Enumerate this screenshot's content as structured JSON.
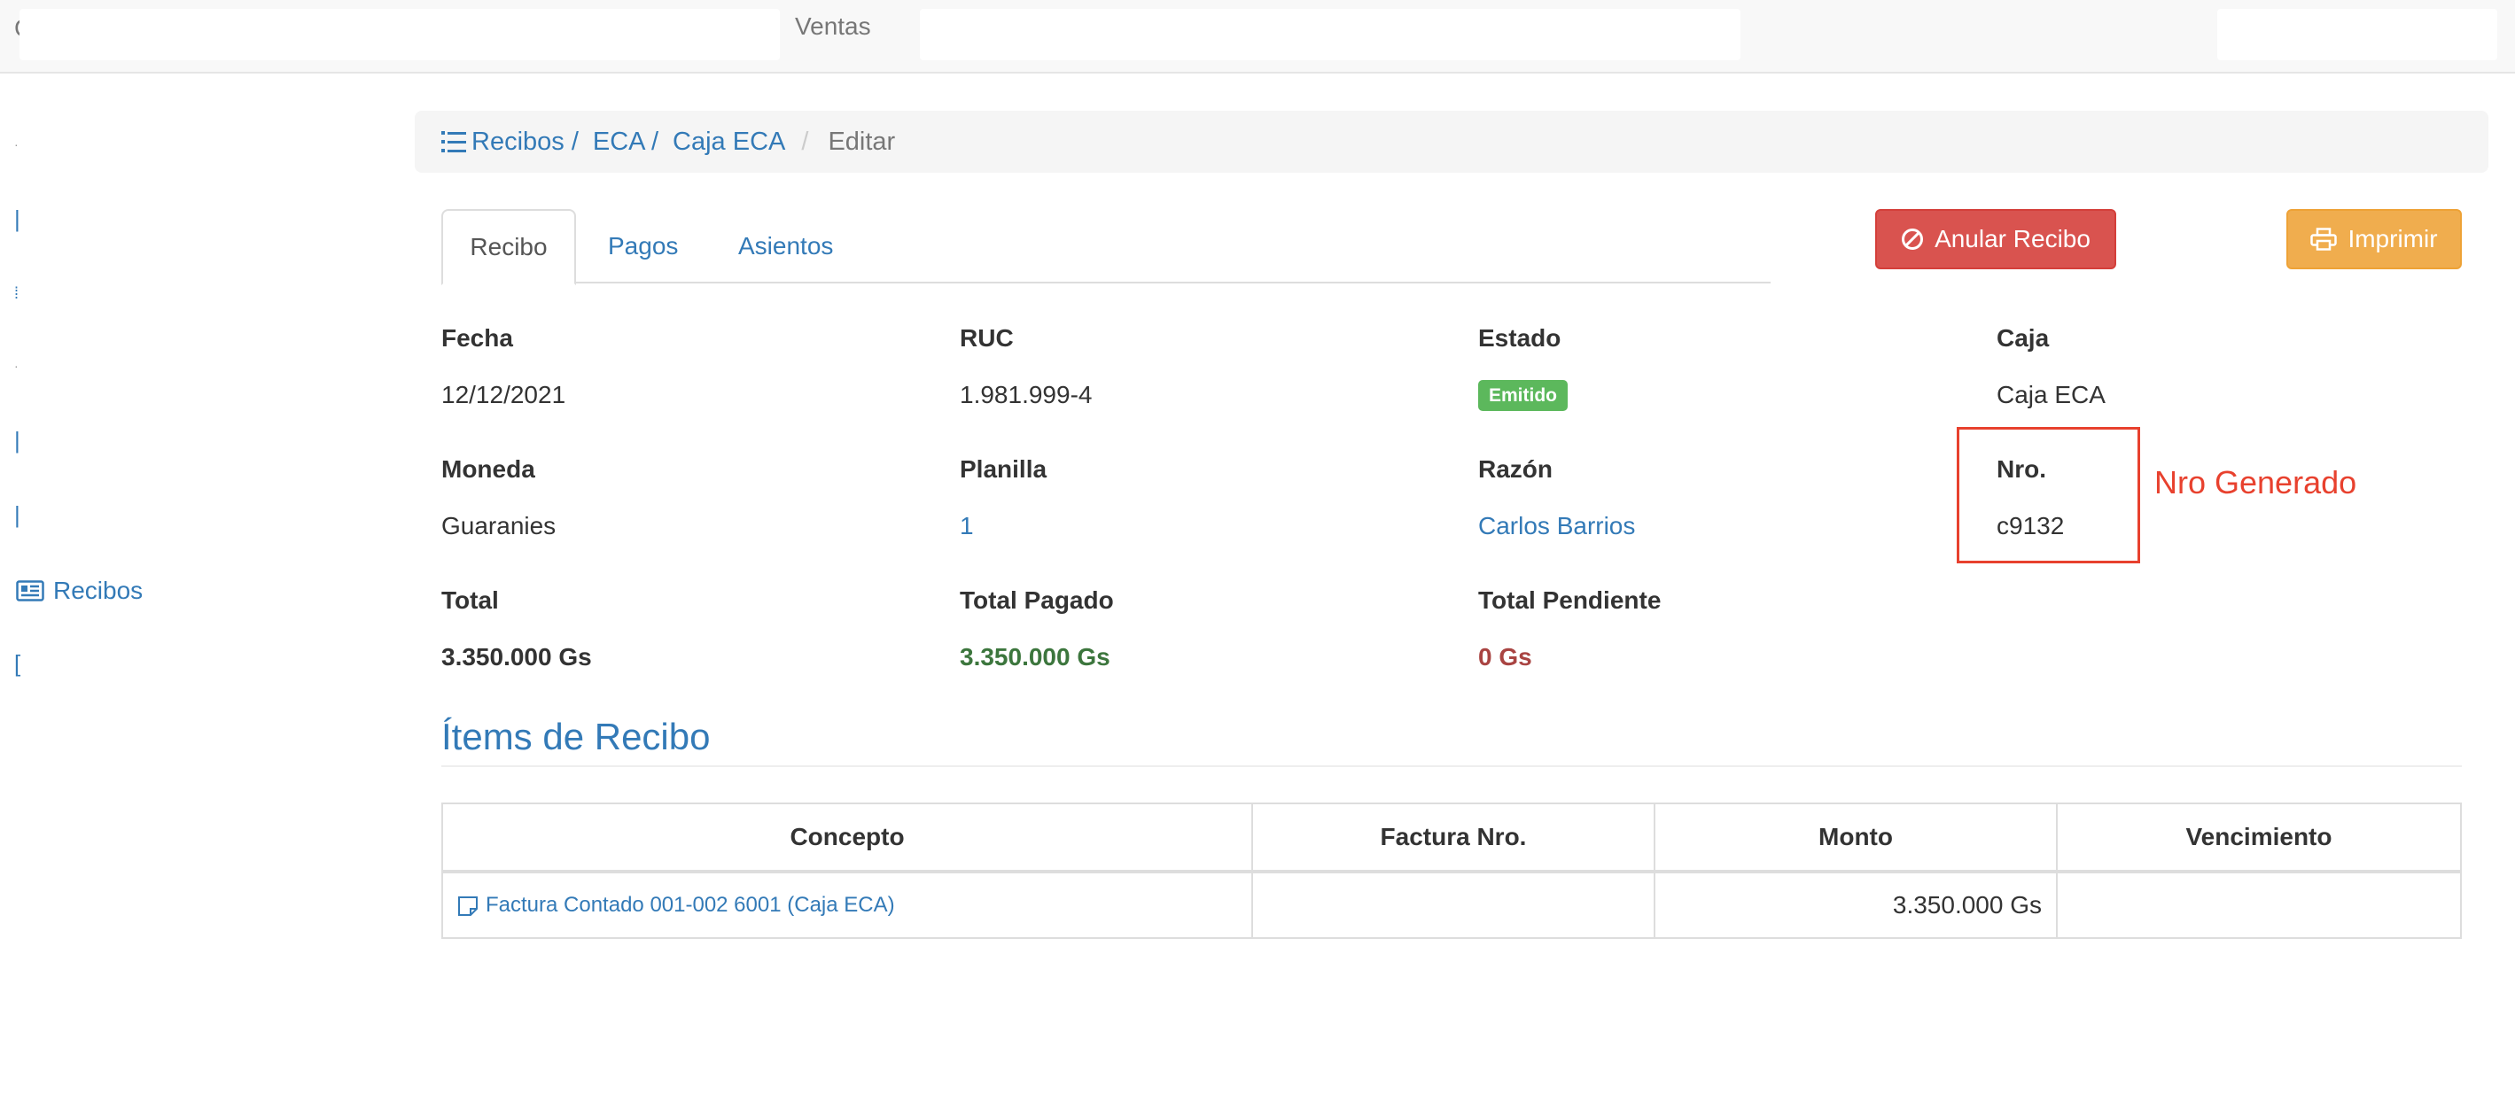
{
  "navbar": {
    "brand_fragment": "C",
    "module_label": "Ventas"
  },
  "sidebar": {
    "active_label": "Recibos"
  },
  "breadcrumb": {
    "items": [
      "Recibos /",
      "ECA /",
      "Caja ECA"
    ],
    "separator": "/",
    "current": "Editar"
  },
  "tabs": [
    "Recibo",
    "Pagos",
    "Asientos"
  ],
  "actions": {
    "cancel_label": "Anular Recibo",
    "print_label": "Imprimir"
  },
  "fields": {
    "fecha": {
      "label": "Fecha",
      "value": "12/12/2021"
    },
    "ruc": {
      "label": "RUC",
      "value": "1.981.999-4"
    },
    "estado": {
      "label": "Estado",
      "value": "Emitido"
    },
    "caja": {
      "label": "Caja",
      "value": "Caja ECA"
    },
    "moneda": {
      "label": "Moneda",
      "value": "Guaranies"
    },
    "planilla": {
      "label": "Planilla",
      "value": "1"
    },
    "razon": {
      "label": "Razón",
      "value": "Carlos Barrios"
    },
    "nro": {
      "label": "Nro.",
      "value": "c9132"
    },
    "total": {
      "label": "Total",
      "value": "3.350.000 Gs"
    },
    "total_pagado": {
      "label": "Total Pagado",
      "value": "3.350.000 Gs"
    },
    "total_pendiente": {
      "label": "Total Pendiente",
      "value": "0 Gs"
    }
  },
  "annotation": "Nro Generado",
  "items_section": {
    "title": "Ítems de Recibo",
    "columns": [
      "Concepto",
      "Factura Nro.",
      "Monto",
      "Vencimiento"
    ],
    "rows": [
      {
        "concepto": "Factura Contado 001-002 6001 (Caja ECA)",
        "factura_nro": "",
        "monto": "3.350.000 Gs",
        "vencimiento": ""
      }
    ]
  },
  "colors": {
    "link": "#337ab7",
    "danger": "#d9534f",
    "warning": "#f0ad4e",
    "success": "#5cb85c",
    "annotation": "#e8412e"
  }
}
